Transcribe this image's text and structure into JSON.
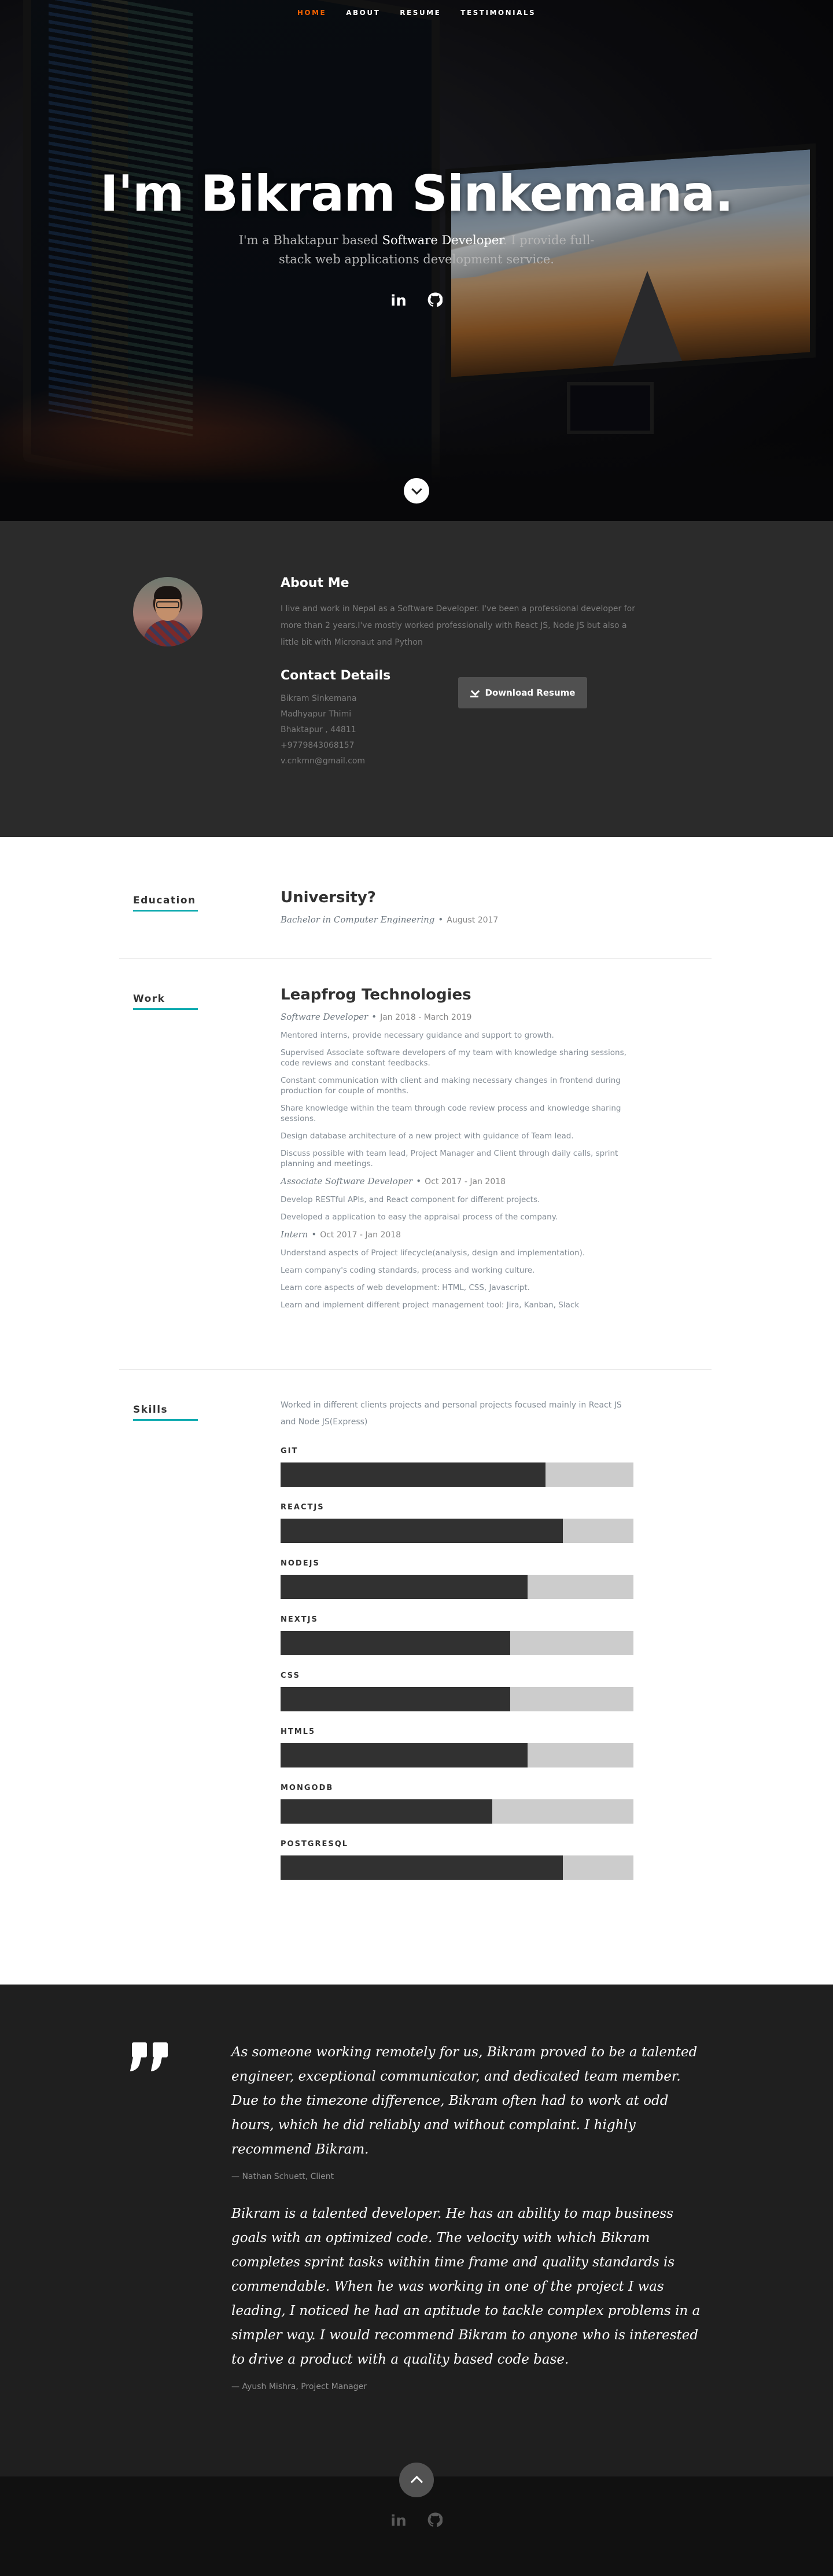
{
  "nav": {
    "items": [
      "Home",
      "About",
      "Resume",
      "Testimonials"
    ],
    "active": "Home"
  },
  "hero": {
    "title": "I'm Bikram Sinkemana.",
    "sub_prefix": "I'm a Bhaktapur based ",
    "sub_highlight": "Software Developer",
    "sub_suffix": ". I provide full-stack web applications development service.",
    "social_icons": [
      "linkedin-icon",
      "github-icon"
    ],
    "social_glyphs": [
      "in",
      "⌥"
    ]
  },
  "about": {
    "heading": "About Me",
    "bio": "I live and work in Nepal as a Software Developer. I've been a professional developer for more than 2 years.I've mostly worked professionally with React JS, Node JS but also a little bit with Micronaut and Python",
    "contact_heading": "Contact Details",
    "contact": [
      "Bikram Sinkemana",
      "Madhyapur Thimi",
      "Bhaktapur , 44811",
      "+9779843068157",
      "v.cnkmn@gmail.com"
    ],
    "download_label": "Download Resume"
  },
  "education": {
    "label": "Education",
    "school": "University?",
    "degree": "Bachelor in Computer Engineering",
    "date": "August 2017"
  },
  "work": {
    "label": "Work",
    "company": "Leapfrog Technologies",
    "roles": [
      {
        "title": "Software Developer",
        "date": "Jan 2018 - March 2019",
        "points": [
          "Mentored interns, provide necessary guidance and support to growth.",
          "Supervised Associate software developers of my team with knowledge sharing sessions, code reviews and constant feedbacks.",
          "Constant communication with client and making necessary changes in frontend during production for couple of months.",
          "Share knowledge within the team through code review process and knowledge sharing sessions.",
          "Design database architecture of a new project with guidance of Team lead.",
          "Discuss possible with team lead, Project Manager and Client through daily calls, sprint planning and meetings."
        ]
      },
      {
        "title": "Associate Software Developer",
        "date": "Oct 2017 - Jan 2018",
        "points": [
          "Develop RESTful APIs, and React component for different projects.",
          "Developed a application to easy the appraisal process of the company."
        ]
      },
      {
        "title": "Intern",
        "date": "Oct 2017 - Jan 2018",
        "points": [
          "Understand aspects of Project lifecycle(analysis, design and implementation).",
          "Learn company's coding standards, process and working culture.",
          "Learn core aspects of web development: HTML, CSS, Javascript.",
          "Learn and implement different project management tool: Jira, Kanban, Slack"
        ]
      }
    ]
  },
  "skills": {
    "label": "Skills",
    "intro": "Worked in different clients projects and personal projects focused mainly in React JS and Node JS(Express)",
    "items": [
      {
        "name": "Git",
        "level": 75
      },
      {
        "name": "ReactJS",
        "level": 80
      },
      {
        "name": "NodeJS",
        "level": 70
      },
      {
        "name": "NextJS",
        "level": 65
      },
      {
        "name": "CSS",
        "level": 65
      },
      {
        "name": "HTML5",
        "level": 70
      },
      {
        "name": "MongoDB",
        "level": 60
      },
      {
        "name": "PostgreSQL",
        "level": 80
      }
    ]
  },
  "testimonials": [
    {
      "text": "As someone working remotely for us, Bikram proved to be a talented engineer, exceptional communicator, and dedicated team member. Due to the timezone difference, Bikram often had to work at odd hours, which he did reliably and without complaint. I highly recommend Bikram.",
      "author": "Nathan Schuett, Client"
    },
    {
      "text": "Bikram is a talented developer. He has an ability to map business goals with an optimized code. The velocity with which Bikram completes sprint tasks within time frame and quality standards is commendable. When he was working in one of the project I was leading, I noticed he had an aptitude to tackle complex problems in a simpler way. I would recommend Bikram to anyone who is interested to drive a product with a quality based code base.",
      "author": "Ayush Mishra, Project Manager"
    }
  ],
  "footer": {
    "social_icons": [
      "linkedin-icon",
      "github-icon"
    ],
    "social_glyphs": [
      "in",
      "⌥"
    ]
  },
  "colors": {
    "accent": "#f06000",
    "teal": "#11abb0",
    "dark": "#2b2b2b"
  }
}
